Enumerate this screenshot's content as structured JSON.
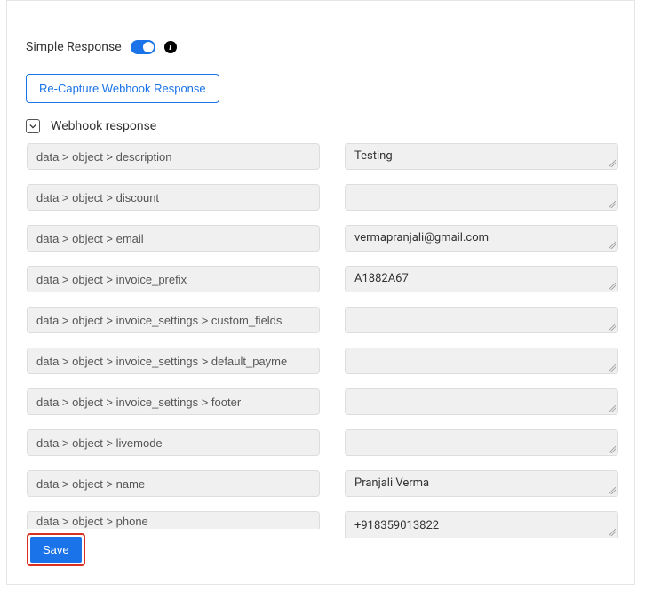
{
  "header": {
    "title": "Simple Response",
    "toggle_on": true,
    "info_char": "i"
  },
  "buttons": {
    "recapture": "Re-Capture Webhook Response",
    "save": "Save"
  },
  "section": {
    "title": "Webhook response"
  },
  "rows": [
    {
      "path": "data > object > description",
      "value": "Testing"
    },
    {
      "path": "data > object > discount",
      "value": ""
    },
    {
      "path": "data > object > email",
      "value": "vermapranjali@gmail.com"
    },
    {
      "path": "data > object > invoice_prefix",
      "value": "A1882A67"
    },
    {
      "path": "data > object > invoice_settings > custom_fields",
      "value": ""
    },
    {
      "path": "data > object > invoice_settings > default_payme",
      "value": ""
    },
    {
      "path": "data > object > invoice_settings > footer",
      "value": ""
    },
    {
      "path": "data > object > livemode",
      "value": ""
    },
    {
      "path": "data > object > name",
      "value": "Pranjali Verma"
    },
    {
      "path": "data > object > phone",
      "value": "+918359013822"
    }
  ]
}
